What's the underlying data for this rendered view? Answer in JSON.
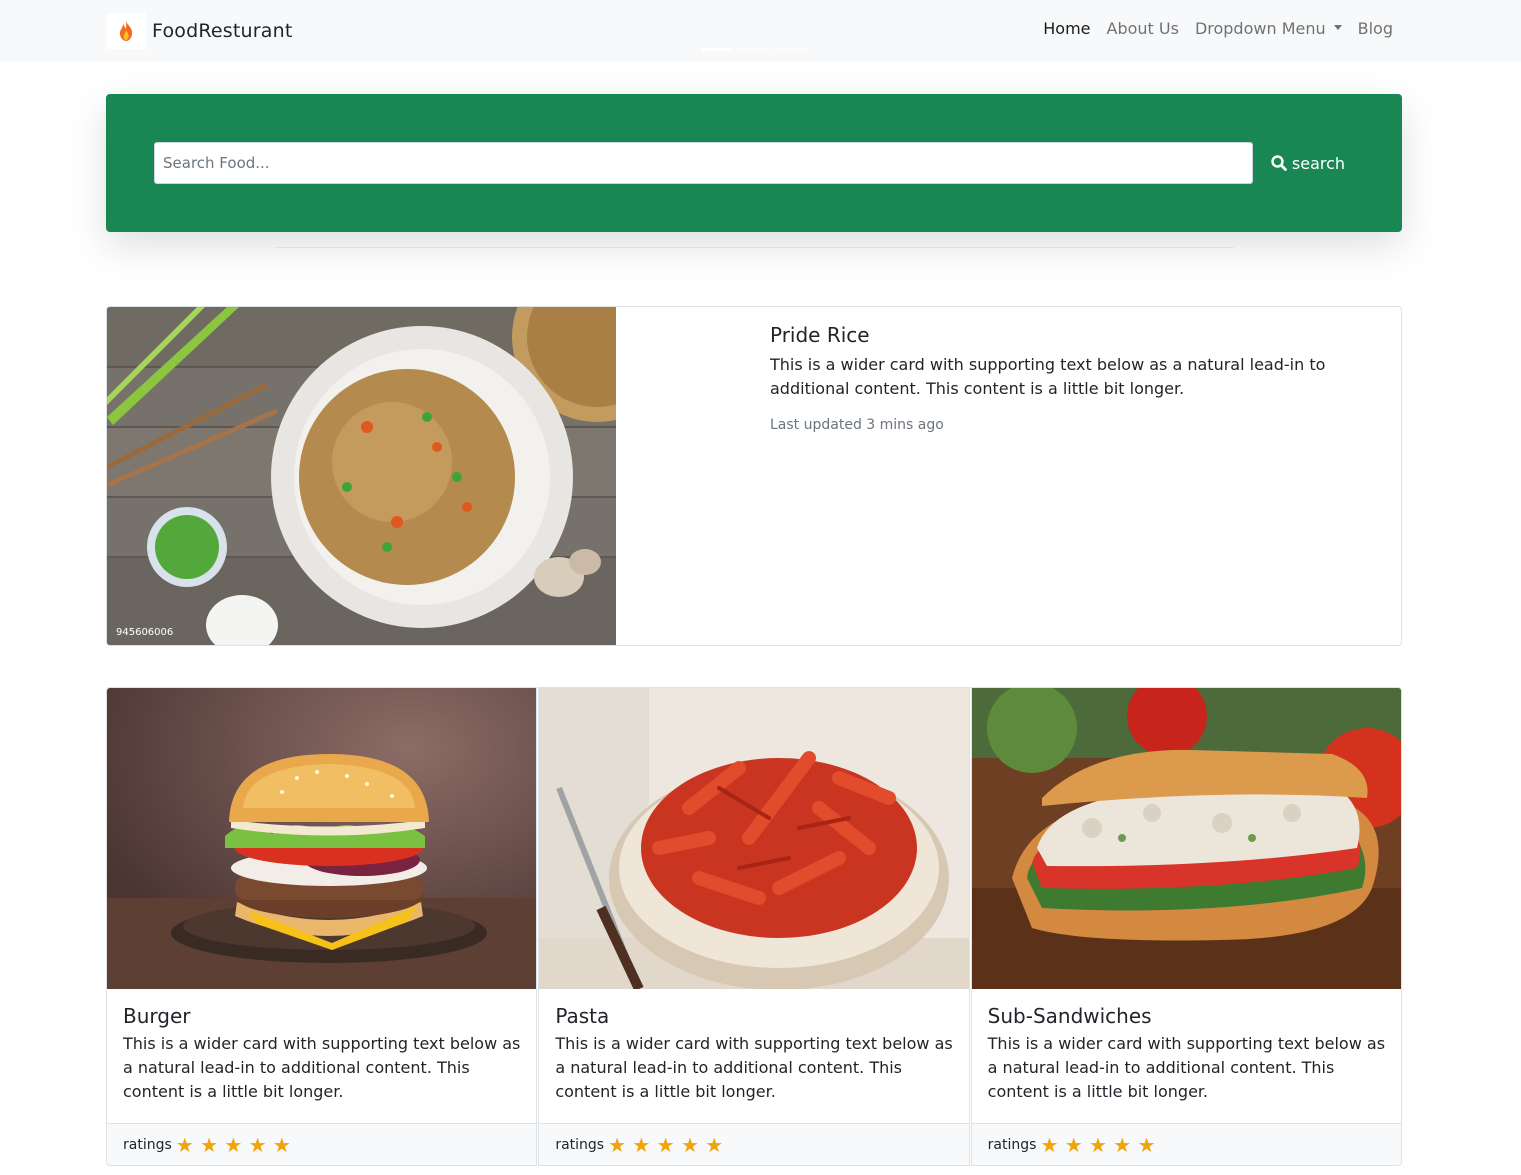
{
  "navbar": {
    "brand": "FoodResturant",
    "links": [
      {
        "label": "Home"
      },
      {
        "label": "About Us"
      },
      {
        "label": "Dropdown Menu"
      },
      {
        "label": "Blog"
      }
    ]
  },
  "search": {
    "placeholder": "Search Food...",
    "button_label": "search"
  },
  "featured": {
    "title": "Pride Rice",
    "text": "This is a wider card with supporting text below as a natural lead-in to additional content. This content is a little bit longer.",
    "updated": "Last updated 3 mins ago",
    "image_code": "945606006"
  },
  "cards": [
    {
      "title": "Burger",
      "text": "This is a wider card with supporting text below as a natural lead-in to additional content. This content is a little bit longer.",
      "ratings_label": "ratings",
      "stars": "★ ★ ★ ★ ★"
    },
    {
      "title": "Pasta",
      "text": "This is a wider card with supporting text below as a natural lead-in to additional content. This content is a little bit longer.",
      "ratings_label": "ratings",
      "stars": "★ ★ ★ ★ ★"
    },
    {
      "title": "Sub-Sandwiches",
      "text": "This is a wider card with supporting text below as a natural lead-in to additional content. This content is a little bit longer.",
      "ratings_label": "ratings",
      "stars": "★ ★ ★ ★ ★"
    }
  ],
  "colors": {
    "accent": "#198754",
    "star": "#f0a30a",
    "navbar_bg": "#f8f9fa"
  }
}
